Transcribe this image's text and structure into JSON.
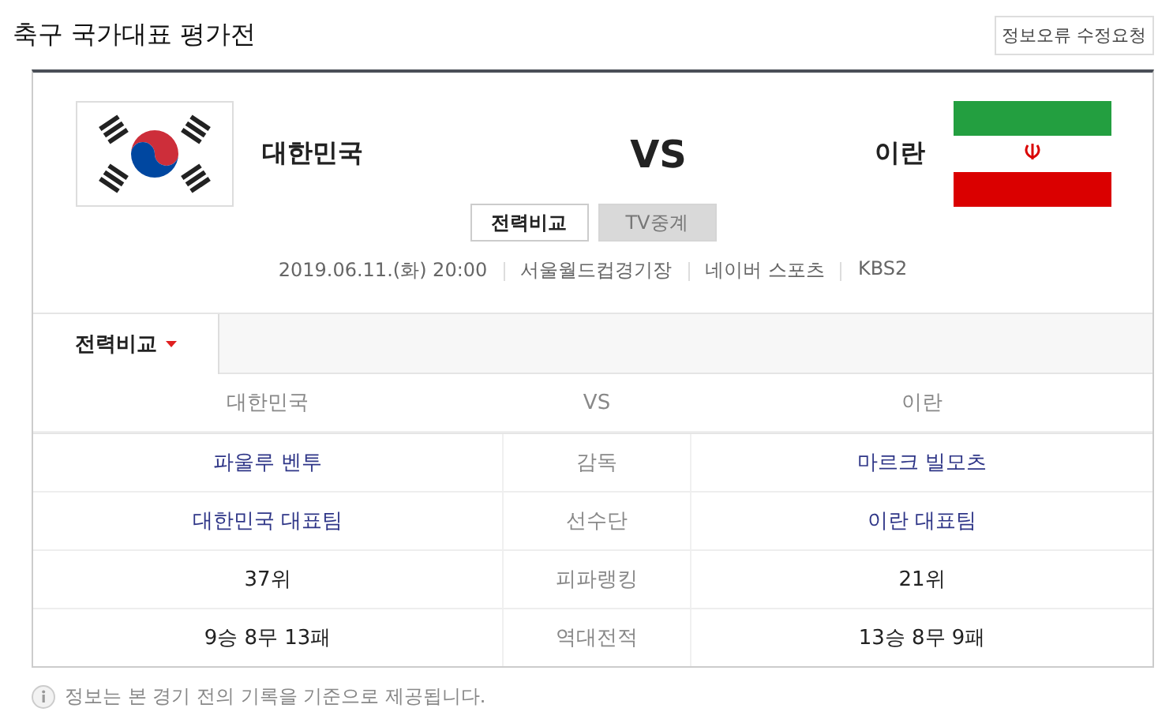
{
  "title": "축구 국가대표 평가전",
  "report_button": "정보오류 수정요청",
  "match": {
    "home": "대한민국",
    "vs": "VS",
    "away": "이란",
    "buttons": [
      {
        "label": "전력비교",
        "selected": true,
        "disabled": false
      },
      {
        "label": "TV중계",
        "selected": false,
        "disabled": true
      }
    ],
    "info": [
      "2019.06.11.(화) 20:00",
      "서울월드컵경기장",
      "네이버 스포츠",
      "KBS2"
    ]
  },
  "tabs": [
    {
      "label": "전력비교",
      "selected": true
    }
  ],
  "table": {
    "header": {
      "left": "대한민국",
      "center": "VS",
      "right": "이란"
    },
    "rows": [
      {
        "left": "파울루 벤투",
        "label": "감독",
        "right": "마르크 빌모츠",
        "linked": true
      },
      {
        "left": "대한민국 대표팀",
        "label": "선수단",
        "right": "이란 대표팀",
        "linked": true
      },
      {
        "left": "37위",
        "label": "피파랭킹",
        "right": "21위",
        "linked": false
      },
      {
        "left": "9승 8무 13패",
        "label": "역대전적",
        "right": "13승 8무 9패",
        "linked": false
      }
    ]
  },
  "notice": "정보는 본 경기 전의 기록을 기준으로 제공됩니다."
}
